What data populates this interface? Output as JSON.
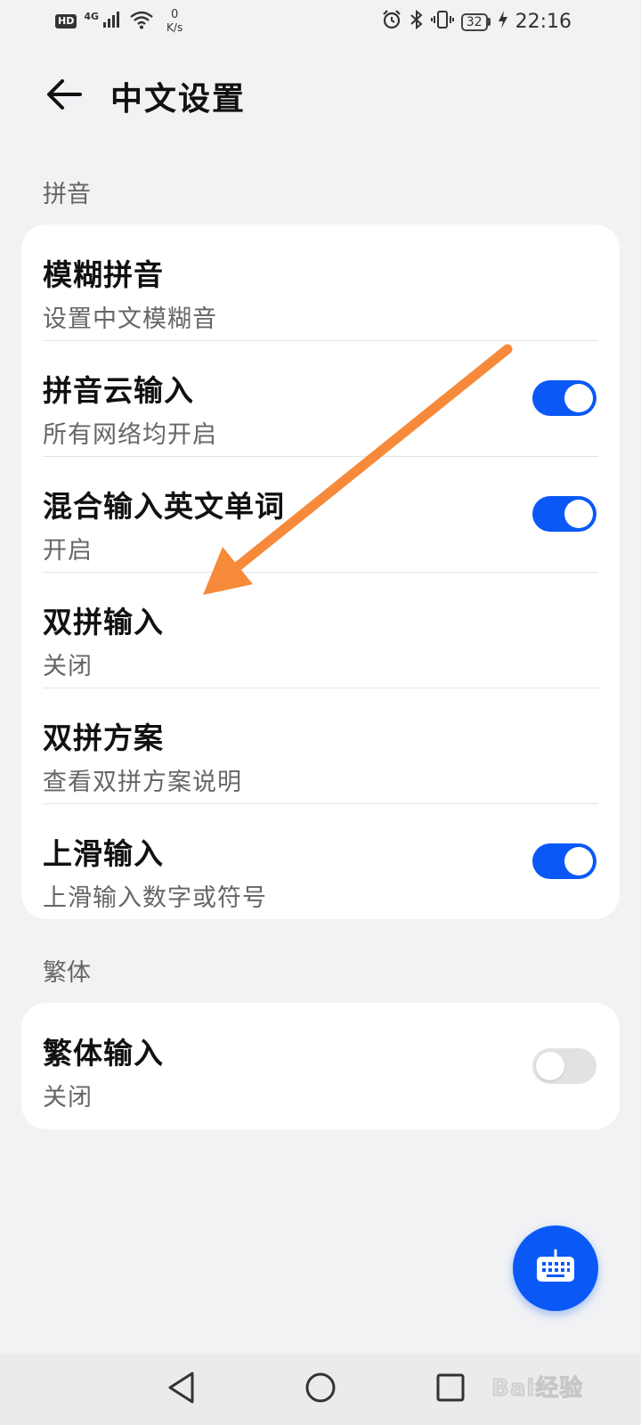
{
  "status_bar": {
    "hd": "HD",
    "network": "4G",
    "speed_value": "0",
    "speed_unit": "K/s",
    "battery": "32",
    "time": "22:16"
  },
  "header": {
    "title": "中文设置"
  },
  "sections": [
    {
      "label": "拼音",
      "items": [
        {
          "title": "模糊拼音",
          "subtitle": "设置中文模糊音",
          "toggle": null
        },
        {
          "title": "拼音云输入",
          "subtitle": "所有网络均开启",
          "toggle": true
        },
        {
          "title": "混合输入英文单词",
          "subtitle": "开启",
          "toggle": true
        },
        {
          "title": "双拼输入",
          "subtitle": "关闭",
          "toggle": null
        },
        {
          "title": "双拼方案",
          "subtitle": "查看双拼方案说明",
          "toggle": null
        },
        {
          "title": "上滑输入",
          "subtitle": "上滑输入数字或符号",
          "toggle": true
        }
      ]
    },
    {
      "label": "繁体",
      "items": [
        {
          "title": "繁体输入",
          "subtitle": "关闭",
          "toggle": false
        }
      ]
    }
  ],
  "watermark": {
    "text": "Bai经验"
  },
  "colors": {
    "accent": "#0a59f7",
    "background": "#f1f2f4",
    "card": "#ffffff",
    "annotation_arrow": "#f68a3a"
  },
  "icons": {
    "back": "arrow-left-icon",
    "fab": "keyboard-icon",
    "nav_back": "triangle-back-icon",
    "nav_home": "circle-home-icon",
    "nav_recents": "square-recents-icon"
  }
}
